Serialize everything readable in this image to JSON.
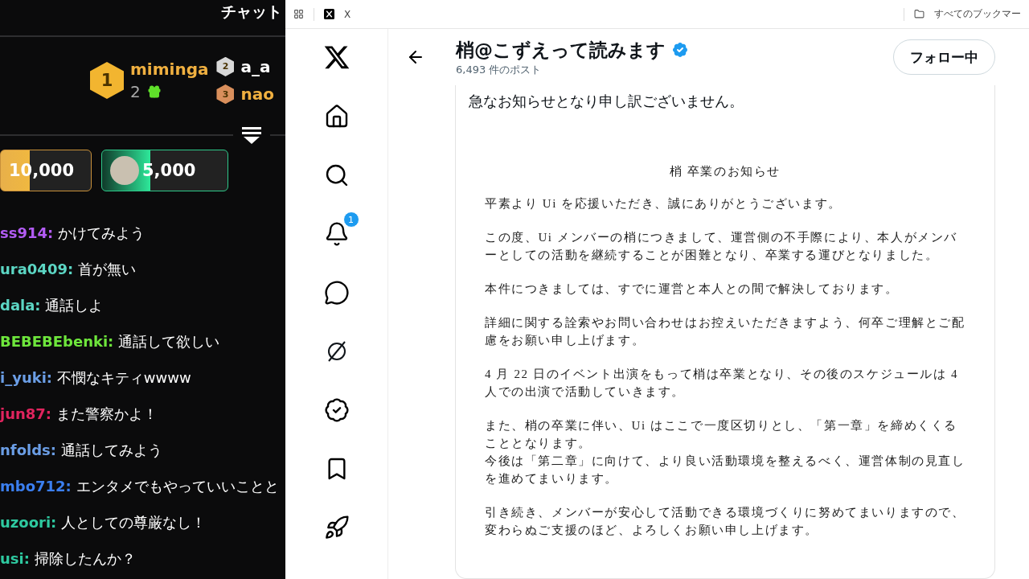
{
  "chat_panel": {
    "title": "チャット",
    "top_gifters": [
      {
        "rank": "1",
        "name": "miminga",
        "count": "2"
      },
      {
        "rank": "2",
        "name": "a_a"
      },
      {
        "rank": "3",
        "name": "nao"
      }
    ],
    "gift_tiers": [
      {
        "amount": "10,000",
        "kind": "gold"
      },
      {
        "amount": "5,000",
        "kind": "green"
      }
    ],
    "messages": [
      {
        "user": "ss914:",
        "color": "#b35cf5",
        "text": "かけてみよう"
      },
      {
        "user": "ura0409:",
        "color": "#5cd6c4",
        "text": "首が無い"
      },
      {
        "user": "dala:",
        "color": "#5cd6c4",
        "text": "通話しよ"
      },
      {
        "user": "BEBEBEbenki:",
        "color": "#6ee63c",
        "text": "通話して欲しい"
      },
      {
        "user": "i_yuki:",
        "color": "#6b9ee6",
        "text": "不憫なキティwwww"
      },
      {
        "user": "jun87:",
        "color": "#e0245e",
        "text": "また警察かよ！"
      },
      {
        "user": "nfolds:",
        "color": "#6b9ee6",
        "text": "通話してみよう"
      },
      {
        "user": "mbo712:",
        "color": "#3b7ff0",
        "text": "エンタメでもやっていいことと"
      },
      {
        "user": "uzoori:",
        "color": "#2ec9a0",
        "text": "人としての尊厳なし！"
      },
      {
        "user": "usi:",
        "color": "#2ec9a0",
        "text": "掃除したんか？"
      }
    ]
  },
  "browser": {
    "tab_title": "X",
    "bookmarks_label": "すべてのブックマー"
  },
  "nav": {
    "notification_count": "1"
  },
  "profile": {
    "name": "梢@こずえって読みます",
    "verified": true,
    "post_count": "6,493 件のポスト",
    "follow_button": "フォロー中"
  },
  "post": {
    "text": "急なお知らせとなり申し訳ございません。",
    "document": {
      "title": "梢 卒業のお知らせ",
      "blocks": [
        [
          "平素より Ui を応援いただき、誠にありがとうございます。"
        ],
        [
          "この度、Ui メンバーの梢につきまして、運営側の不手際により、本人がメンバーとしての活動を継続することが困難となり、卒業する運びとなりました。"
        ],
        [
          "本件につきましては、すでに運営と本人との間で解決しております。"
        ],
        [
          "詳細に関する詮索やお問い合わせはお控えいただきますよう、何卒ご理解とご配慮をお願い申し上げます。"
        ],
        [
          "4 月 22 日のイベント出演をもって梢は卒業となり、その後のスケジュールは 4 人での出演で活動していきます。"
        ],
        [
          "また、梢の卒業に伴い、Ui はここで一度区切りとし、「第一章」を締めくくることとなります。",
          "今後は「第二章」に向けて、より良い活動環境を整えるべく、運営体制の見直しを進めてまいります。"
        ],
        [
          "引き続き、メンバーが安心して活動できる環境づくりに努めてまいりますので、変わらぬご支援のほど、よろしくお願い申し上げます。"
        ]
      ]
    }
  }
}
